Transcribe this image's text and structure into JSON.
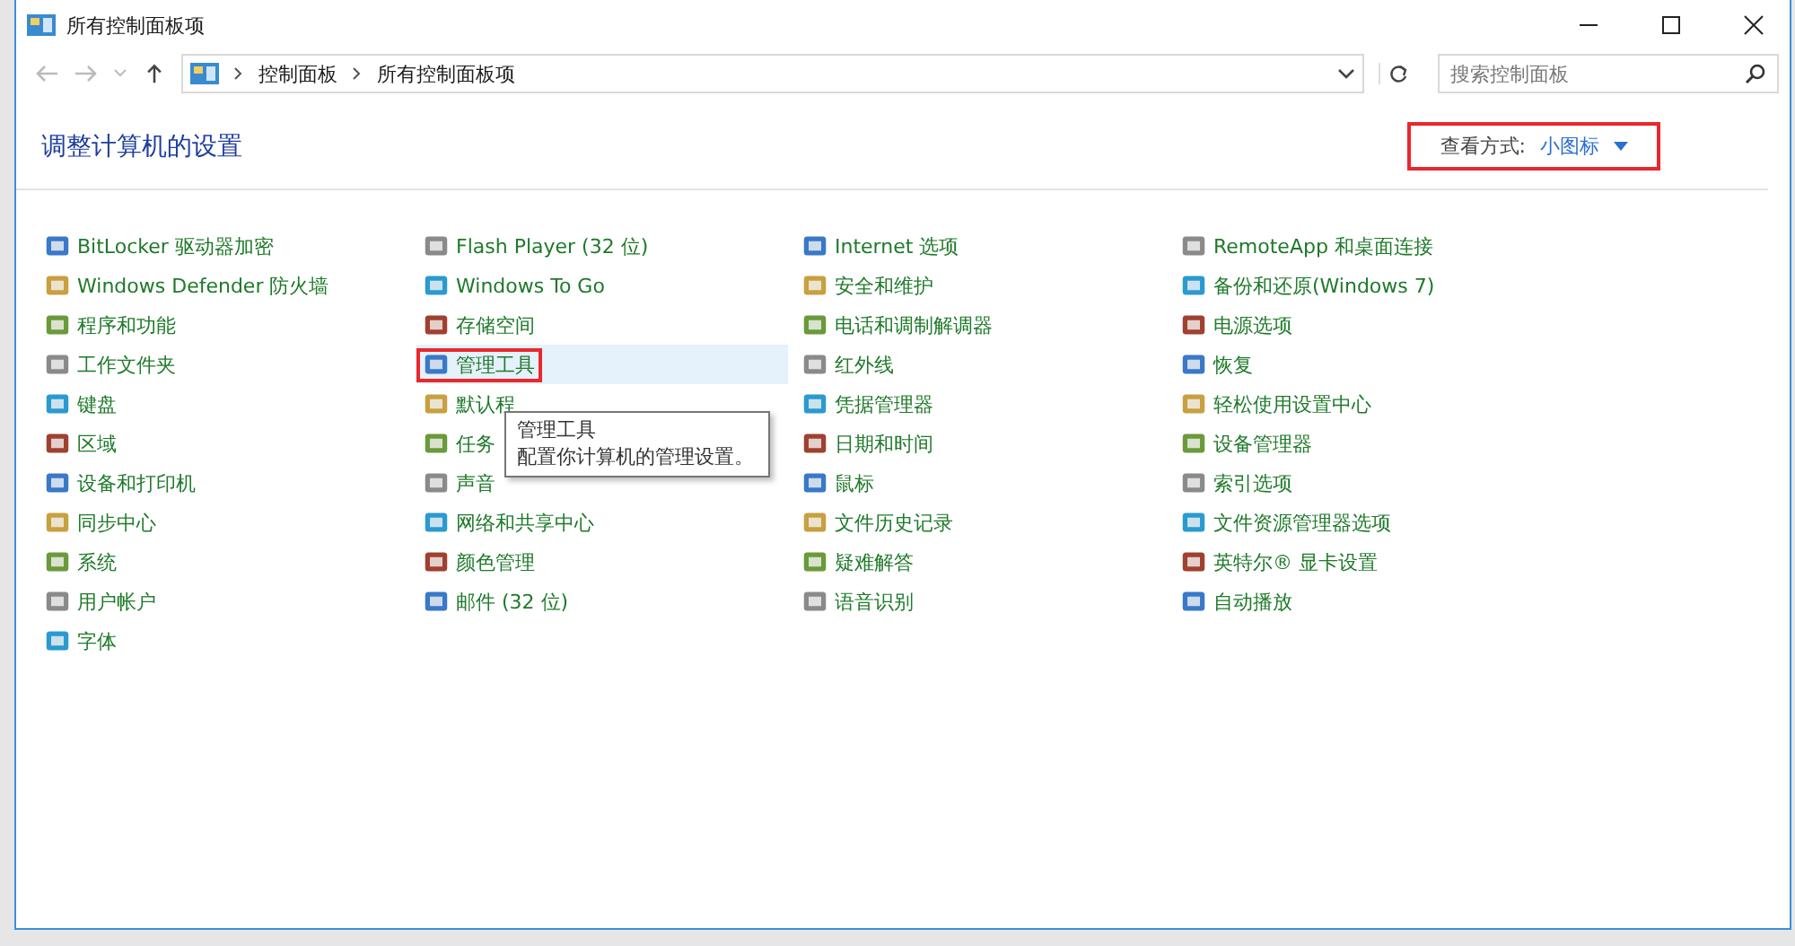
{
  "window": {
    "title": "所有控制面板项"
  },
  "address_bar": {
    "crumbs": [
      "控制面板",
      "所有控制面板项"
    ]
  },
  "search": {
    "placeholder": "搜索控制面板"
  },
  "heading": "调整计算机的设置",
  "view_by": {
    "label": "查看方式:",
    "value": "小图标",
    "annotated": true
  },
  "columns": [
    [
      {
        "label": "BitLocker 驱动器加密",
        "hovered": false,
        "annotated": false
      },
      {
        "label": "Windows Defender 防火墙",
        "hovered": false,
        "annotated": false
      },
      {
        "label": "程序和功能",
        "hovered": false,
        "annotated": false
      },
      {
        "label": "工作文件夹",
        "hovered": false,
        "annotated": false
      },
      {
        "label": "键盘",
        "hovered": false,
        "annotated": false
      },
      {
        "label": "区域",
        "hovered": false,
        "annotated": false
      },
      {
        "label": "设备和打印机",
        "hovered": false,
        "annotated": false
      },
      {
        "label": "同步中心",
        "hovered": false,
        "annotated": false
      },
      {
        "label": "系统",
        "hovered": false,
        "annotated": false
      },
      {
        "label": "用户帐户",
        "hovered": false,
        "annotated": false
      },
      {
        "label": "字体",
        "hovered": false,
        "annotated": false
      }
    ],
    [
      {
        "label": "Flash Player (32 位)",
        "hovered": false,
        "annotated": false
      },
      {
        "label": "Windows To Go",
        "hovered": false,
        "annotated": false
      },
      {
        "label": "存储空间",
        "hovered": false,
        "annotated": false
      },
      {
        "label": "管理工具",
        "hovered": true,
        "annotated": true
      },
      {
        "label": "默认程",
        "hovered": false,
        "annotated": false
      },
      {
        "label": "任务",
        "hovered": false,
        "annotated": false
      },
      {
        "label": "声音",
        "hovered": false,
        "annotated": false
      },
      {
        "label": "网络和共享中心",
        "hovered": false,
        "annotated": false
      },
      {
        "label": "颜色管理",
        "hovered": false,
        "annotated": false
      },
      {
        "label": "邮件 (32 位)",
        "hovered": false,
        "annotated": false
      }
    ],
    [
      {
        "label": "Internet 选项",
        "hovered": false,
        "annotated": false
      },
      {
        "label": "安全和维护",
        "hovered": false,
        "annotated": false
      },
      {
        "label": "电话和调制解调器",
        "hovered": false,
        "annotated": false
      },
      {
        "label": "红外线",
        "hovered": false,
        "annotated": false
      },
      {
        "label": "凭据管理器",
        "hovered": false,
        "annotated": false
      },
      {
        "label": "日期和时间",
        "hovered": false,
        "annotated": false
      },
      {
        "label": "鼠标",
        "hovered": false,
        "annotated": false
      },
      {
        "label": "文件历史记录",
        "hovered": false,
        "annotated": false
      },
      {
        "label": "疑难解答",
        "hovered": false,
        "annotated": false
      },
      {
        "label": "语音识别",
        "hovered": false,
        "annotated": false
      }
    ],
    [
      {
        "label": "RemoteApp 和桌面连接",
        "hovered": false,
        "annotated": false
      },
      {
        "label": "备份和还原(Windows 7)",
        "hovered": false,
        "annotated": false
      },
      {
        "label": "电源选项",
        "hovered": false,
        "annotated": false
      },
      {
        "label": "恢复",
        "hovered": false,
        "annotated": false
      },
      {
        "label": "轻松使用设置中心",
        "hovered": false,
        "annotated": false
      },
      {
        "label": "设备管理器",
        "hovered": false,
        "annotated": false
      },
      {
        "label": "索引选项",
        "hovered": false,
        "annotated": false
      },
      {
        "label": "文件资源管理器选项",
        "hovered": false,
        "annotated": false
      },
      {
        "label": "英特尔® 显卡设置",
        "hovered": false,
        "annotated": false
      },
      {
        "label": "自动播放",
        "hovered": false,
        "annotated": false
      }
    ]
  ],
  "tooltip": {
    "title": "管理工具",
    "text": "配置你计算机的管理设置。"
  }
}
